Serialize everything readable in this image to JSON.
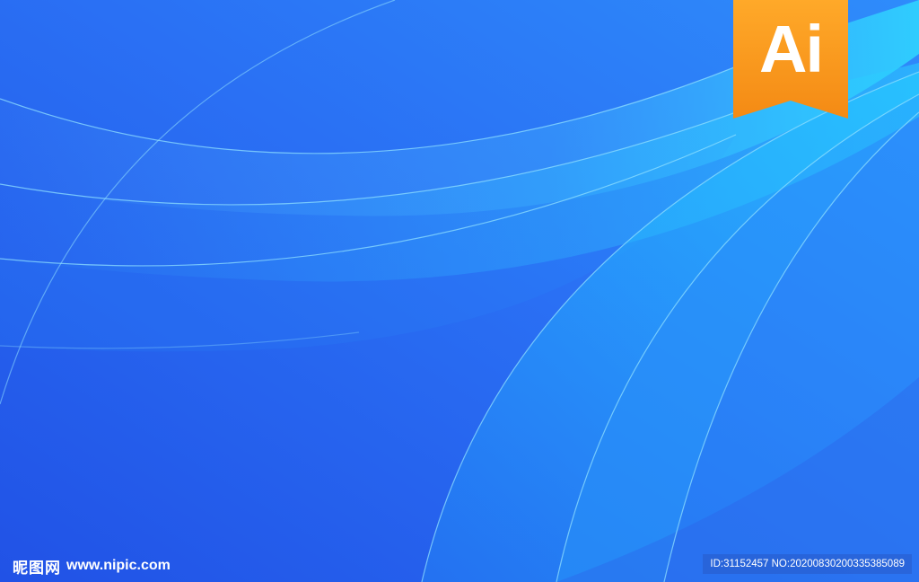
{
  "badge": {
    "text": "Ai",
    "color": "#f7941d"
  },
  "watermark": {
    "brand": "昵图网",
    "url": "www.nipic.com",
    "id_text": "ID:31152457 NO:20200830200335385089"
  },
  "palette": {
    "background": "#2a6cf2",
    "accent": "#2fd0ff"
  }
}
